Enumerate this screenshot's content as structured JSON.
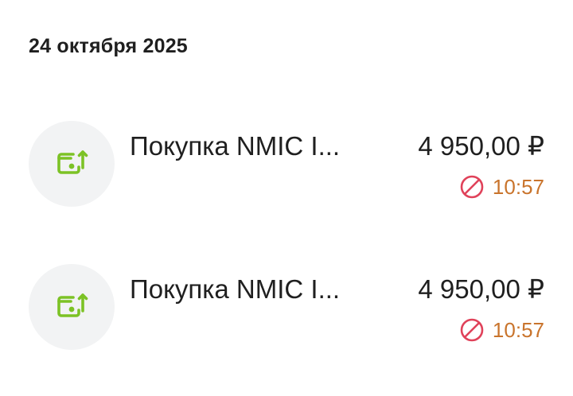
{
  "date_header": "24 октября 2025",
  "colors": {
    "icon_green": "#7cc225",
    "icon_bg": "#f2f3f4",
    "status_red": "#e0425a",
    "time_orange": "#c9742c"
  },
  "transactions": [
    {
      "icon": "wallet-up-arrow-icon",
      "title": "Покупка NMIC I...",
      "amount": "4 950,00 ₽",
      "status_icon": "declined-icon",
      "time": "10:57"
    },
    {
      "icon": "wallet-up-arrow-icon",
      "title": "Покупка NMIC I...",
      "amount": "4 950,00 ₽",
      "status_icon": "declined-icon",
      "time": "10:57"
    }
  ]
}
